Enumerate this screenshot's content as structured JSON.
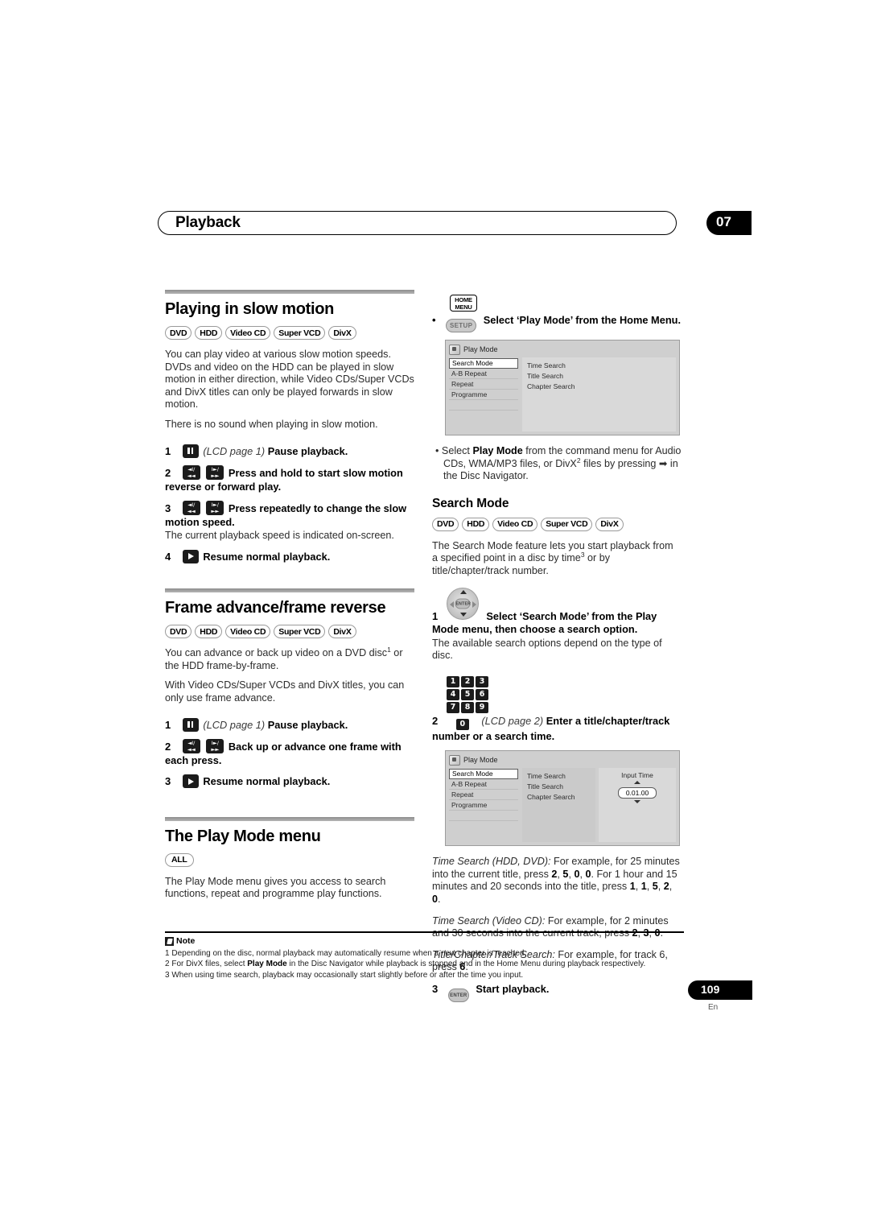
{
  "header": {
    "title": "Playback",
    "chapter": "07"
  },
  "footer": {
    "page": "109",
    "lang": "En"
  },
  "badges": {
    "dvd": "DVD",
    "hdd": "HDD",
    "video_cd": "Video CD",
    "super_vcd": "Super VCD",
    "divx": "DivX",
    "all": "ALL"
  },
  "left": {
    "slow_motion": {
      "heading": "Playing in slow motion",
      "para1": "You can play video at various slow motion speeds. DVDs and video on the HDD can be played in slow motion in either direction, while Video CDs/Super VCDs and DivX titles can only be played forwards in slow motion.",
      "para2": "There is no sound when playing in slow motion.",
      "steps": [
        {
          "num": "1",
          "lcd": "(LCD page 1)",
          "bold": "Pause playback."
        },
        {
          "num": "2",
          "bold": "Press and hold to start slow motion reverse or forward play."
        },
        {
          "num": "3",
          "bold": "Press repeatedly to change the slow motion speed.",
          "desc": "The current playback speed is indicated on-screen."
        },
        {
          "num": "4",
          "bold": "Resume normal playback."
        }
      ]
    },
    "frame_advance": {
      "heading": "Frame advance/frame reverse",
      "para1_a": "You can advance or back up video on a DVD disc",
      "para1_sup": "1",
      "para1_b": " or the HDD frame-by-frame.",
      "para2": "With Video CDs/Super VCDs and DivX titles, you can only use frame advance.",
      "steps": [
        {
          "num": "1",
          "lcd": "(LCD page 1)",
          "bold": "Pause playback."
        },
        {
          "num": "2",
          "bold": "Back up or advance one frame with each press."
        },
        {
          "num": "3",
          "bold": "Resume normal playback."
        }
      ]
    },
    "play_mode_menu": {
      "heading": "The Play Mode menu",
      "para1": "The Play Mode menu gives you access to search functions, repeat and programme play functions."
    }
  },
  "right": {
    "home_menu_bullet": {
      "home_menu_key": "HOME MENU",
      "home_menu_line1": "HOME",
      "home_menu_line2": "MENU",
      "setup_key": "SETUP",
      "text": "Select ‘Play Mode’ from the Home Menu."
    },
    "osd1": {
      "title": "Play Mode",
      "menu": [
        "Search Mode",
        "A-B Repeat",
        "Repeat",
        "Programme"
      ],
      "selected": "Search Mode",
      "options": [
        "Time Search",
        "Title Search",
        "Chapter Search"
      ]
    },
    "command_menu_bullet": {
      "a": "Select ",
      "bold": "Play Mode",
      "b": " from the command menu for Audio CDs, WMA/MP3 files, or DivX",
      "sup": "2",
      "c": " files by pressing ",
      "arrow": "➡",
      "d": " in the Disc Navigator."
    },
    "search_mode": {
      "heading": "Search Mode",
      "para1_a": "The Search Mode feature lets you start playback from a specified point in a disc by time",
      "para1_sup": "3",
      "para1_b": " or by title/chapter/track number.",
      "steps": [
        {
          "num": "1",
          "bold": "Select ‘Search Mode’ from the Play Mode menu, then choose a search option.",
          "desc": "The available search options depend on the type of disc."
        },
        {
          "num": "2",
          "lcd": "(LCD page 2)",
          "bold": "Enter a title/chapter/track number or a search time."
        },
        {
          "num": "3",
          "bold": "Start playback."
        }
      ],
      "enter_key": "ENTER",
      "keypad": [
        "1",
        "2",
        "3",
        "4",
        "5",
        "6",
        "7",
        "8",
        "9",
        "0"
      ]
    },
    "osd2": {
      "title": "Play Mode",
      "menu": [
        "Search Mode",
        "A-B Repeat",
        "Repeat",
        "Programme"
      ],
      "selected": "Search Mode",
      "options": [
        "Time Search",
        "Title Search",
        "Chapter Search"
      ],
      "selected_option": "Time Search",
      "input_label": "Input Time",
      "input_value": "0.01.00"
    },
    "examples": [
      {
        "label": "Time Search (HDD, DVD):",
        "t1": " For example, for 25 minutes into the current title, press ",
        "k1": "2",
        "k2": "5",
        "k3": "0",
        "k4": "0",
        "t2": ". For 1 hour and 15 minutes and 20 seconds into the title, press ",
        "k5": "1",
        "k6": "1",
        "k7": "5",
        "k8": "2",
        "k9": "0",
        "t3": "."
      },
      {
        "label": "Time Search (Video CD):",
        "t1": " For example, for 2 minutes and 30 seconds into the current track, press ",
        "k1": "2",
        "k2": "3",
        "k3": "0",
        "t3": "."
      },
      {
        "label": "Title/Chapter/Track Search:",
        "t1": " For example, for track 6, press ",
        "k1": "6",
        "t3": "."
      }
    ]
  },
  "notes": {
    "label": "Note",
    "items": [
      {
        "num": "1",
        "text": "Depending on the disc, normal playback may automatically resume when a new chapter is reached."
      },
      {
        "num": "2",
        "pre": "For DivX files, select ",
        "bold": "Play Mode",
        "post": " in the Disc Navigator while playback is stopped and in the Home Menu during playback respectively."
      },
      {
        "num": "3",
        "text": "When using time search, playback may occasionally start slightly before or after the time you input."
      }
    ]
  }
}
